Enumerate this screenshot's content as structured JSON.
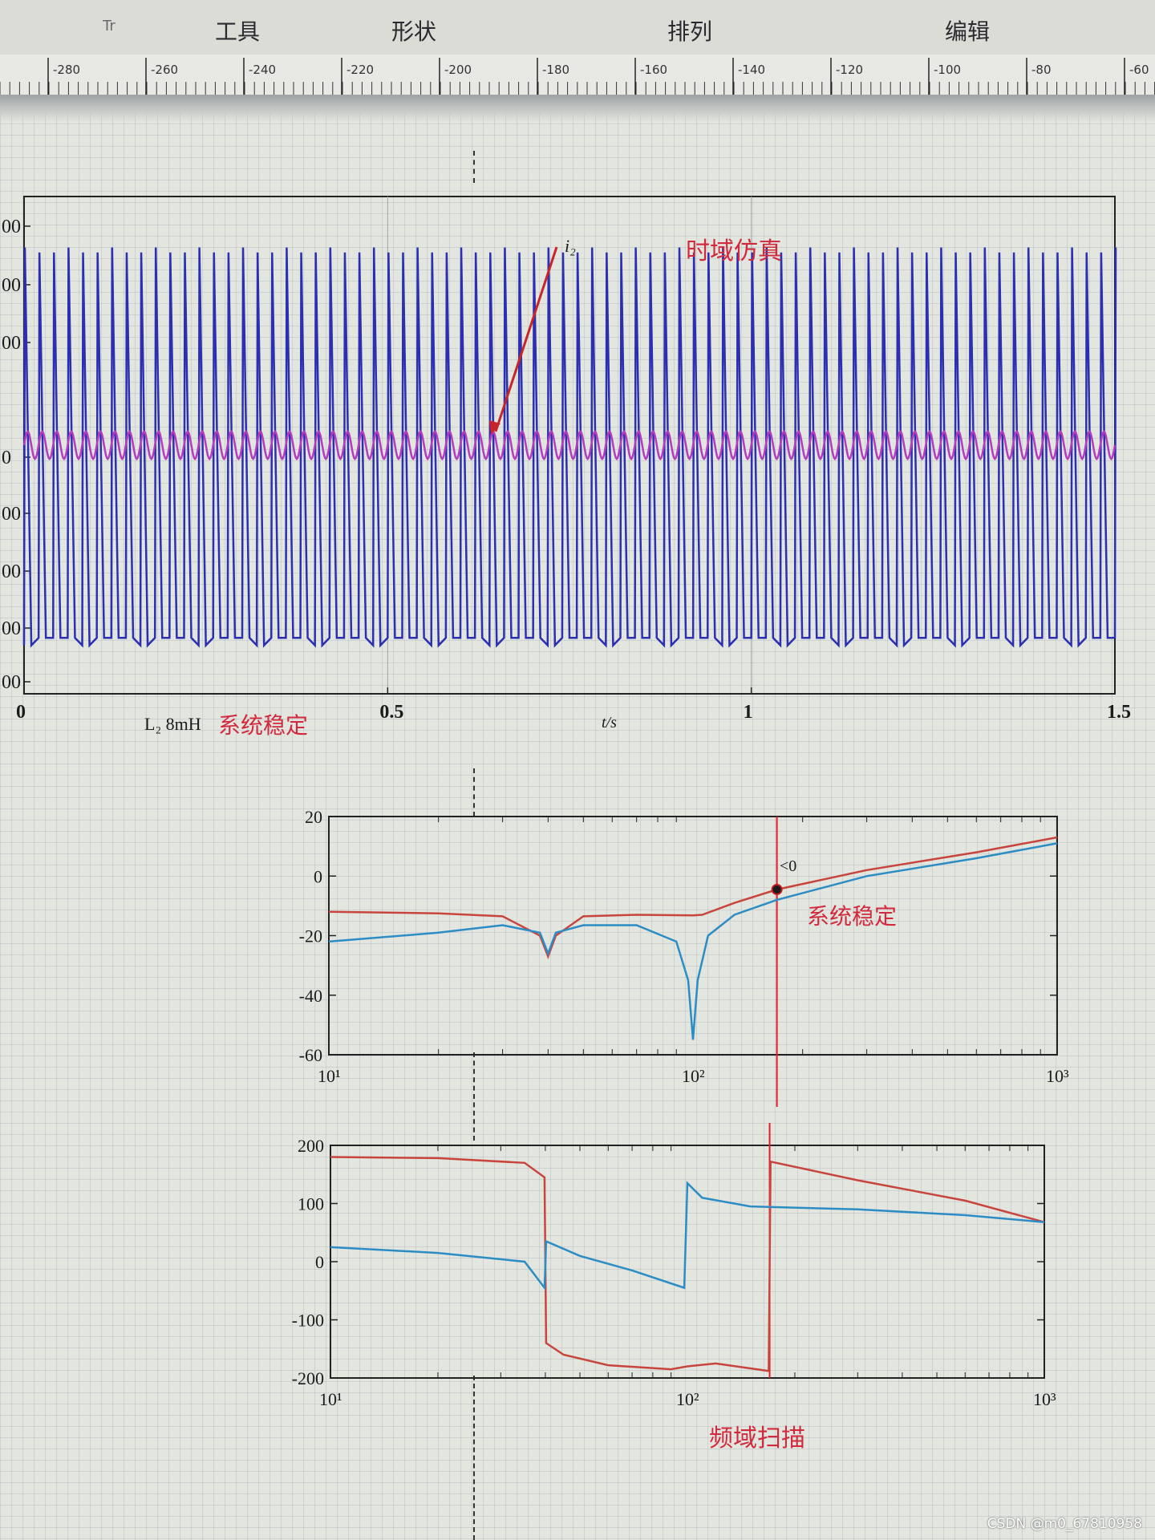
{
  "menubar": {
    "items": [
      "工具",
      "形状",
      "排列",
      "编辑"
    ],
    "left_glyph": "Tr"
  },
  "ruler": {
    "labels": [
      "-280",
      "-260",
      "-240",
      "-220",
      "-200",
      "-180",
      "-160",
      "-140",
      "-120",
      "-100",
      "-80",
      "-60"
    ]
  },
  "annotations": {
    "time_domain": "时域仿真",
    "system_stable_1": "系统稳定",
    "system_stable_2": "系统稳定",
    "freq_scan": "频域扫描",
    "inductance_label": "L₂ 8mH",
    "current_label": "i₂",
    "point_label": "<0",
    "watermark": "CSDN @m0_67810958"
  },
  "chart_data": [
    {
      "type": "line",
      "name": "time-domain",
      "xlabel": "t/s",
      "ylabel": "",
      "xlim": [
        0,
        1.5
      ],
      "x_ticks": [
        "0",
        "0.5",
        "1",
        "1.5"
      ],
      "y_ticks_visible": [
        "00",
        "00",
        "00",
        "0",
        "00",
        "00",
        "00",
        "00"
      ],
      "ylim": [
        -400,
        400
      ],
      "series": [
        {
          "name": "",
          "color": "#2b2fb0",
          "kind": "oscillation",
          "cycles": 75,
          "amplitude_high": 310,
          "amplitude_low": -310,
          "offset": 0
        },
        {
          "name": "i₂",
          "color": "#b43cbf",
          "kind": "oscillation",
          "cycles": 75,
          "amplitude": 22,
          "offset": 0
        }
      ]
    },
    {
      "type": "line",
      "name": "magnitude",
      "xscale": "log",
      "xlim": [
        10,
        1000
      ],
      "ylim": [
        -60,
        20
      ],
      "x_ticks": [
        "10¹",
        "10²",
        "10³"
      ],
      "y_ticks": [
        "20",
        "0",
        "-20",
        "-40",
        "-60"
      ],
      "vline_x": 170,
      "series": [
        {
          "name": "",
          "color": "#c8453e",
          "x": [
            10,
            20,
            30,
            38,
            40,
            42,
            50,
            70,
            100,
            106,
            130,
            170,
            300,
            600,
            1000
          ],
          "y": [
            -12,
            -12.5,
            -13.5,
            -20,
            -27,
            -20,
            -13.5,
            -13,
            -13.2,
            -13,
            -9,
            -4.5,
            2,
            8,
            13
          ]
        },
        {
          "name": "",
          "color": "#2c8dc4",
          "x": [
            10,
            20,
            30,
            38,
            40,
            42,
            50,
            70,
            90,
            97,
            100,
            103,
            110,
            130,
            170,
            300,
            600,
            1000
          ],
          "y": [
            -22,
            -19,
            -16.5,
            -19,
            -26,
            -19,
            -16.5,
            -16.5,
            -22,
            -35,
            -55,
            -35,
            -20,
            -13,
            -8,
            0,
            6,
            11
          ]
        }
      ]
    },
    {
      "type": "line",
      "name": "phase",
      "xscale": "log",
      "xlim": [
        10,
        1000
      ],
      "ylim": [
        -200,
        200
      ],
      "x_ticks": [
        "10¹",
        "10²",
        "10³"
      ],
      "y_ticks": [
        "200",
        "100",
        "0",
        "-100",
        "-200"
      ],
      "vline_x": 170,
      "series": [
        {
          "name": "",
          "color": "#c8453e",
          "x": [
            10,
            20,
            35,
            39.8,
            40.2,
            45,
            60,
            90,
            100,
            120,
            169,
            171,
            300,
            600,
            1000
          ],
          "y": [
            180,
            178,
            170,
            145,
            -140,
            -160,
            -178,
            -185,
            -180,
            -175,
            -188,
            172,
            140,
            105,
            68
          ]
        },
        {
          "name": "",
          "color": "#2c8dc4",
          "x": [
            10,
            20,
            35,
            39.8,
            40.2,
            50,
            70,
            98,
            100,
            110,
            150,
            300,
            600,
            1000
          ],
          "y": [
            25,
            15,
            0,
            -45,
            35,
            10,
            -15,
            -45,
            135,
            110,
            95,
            90,
            80,
            68
          ]
        }
      ]
    }
  ]
}
